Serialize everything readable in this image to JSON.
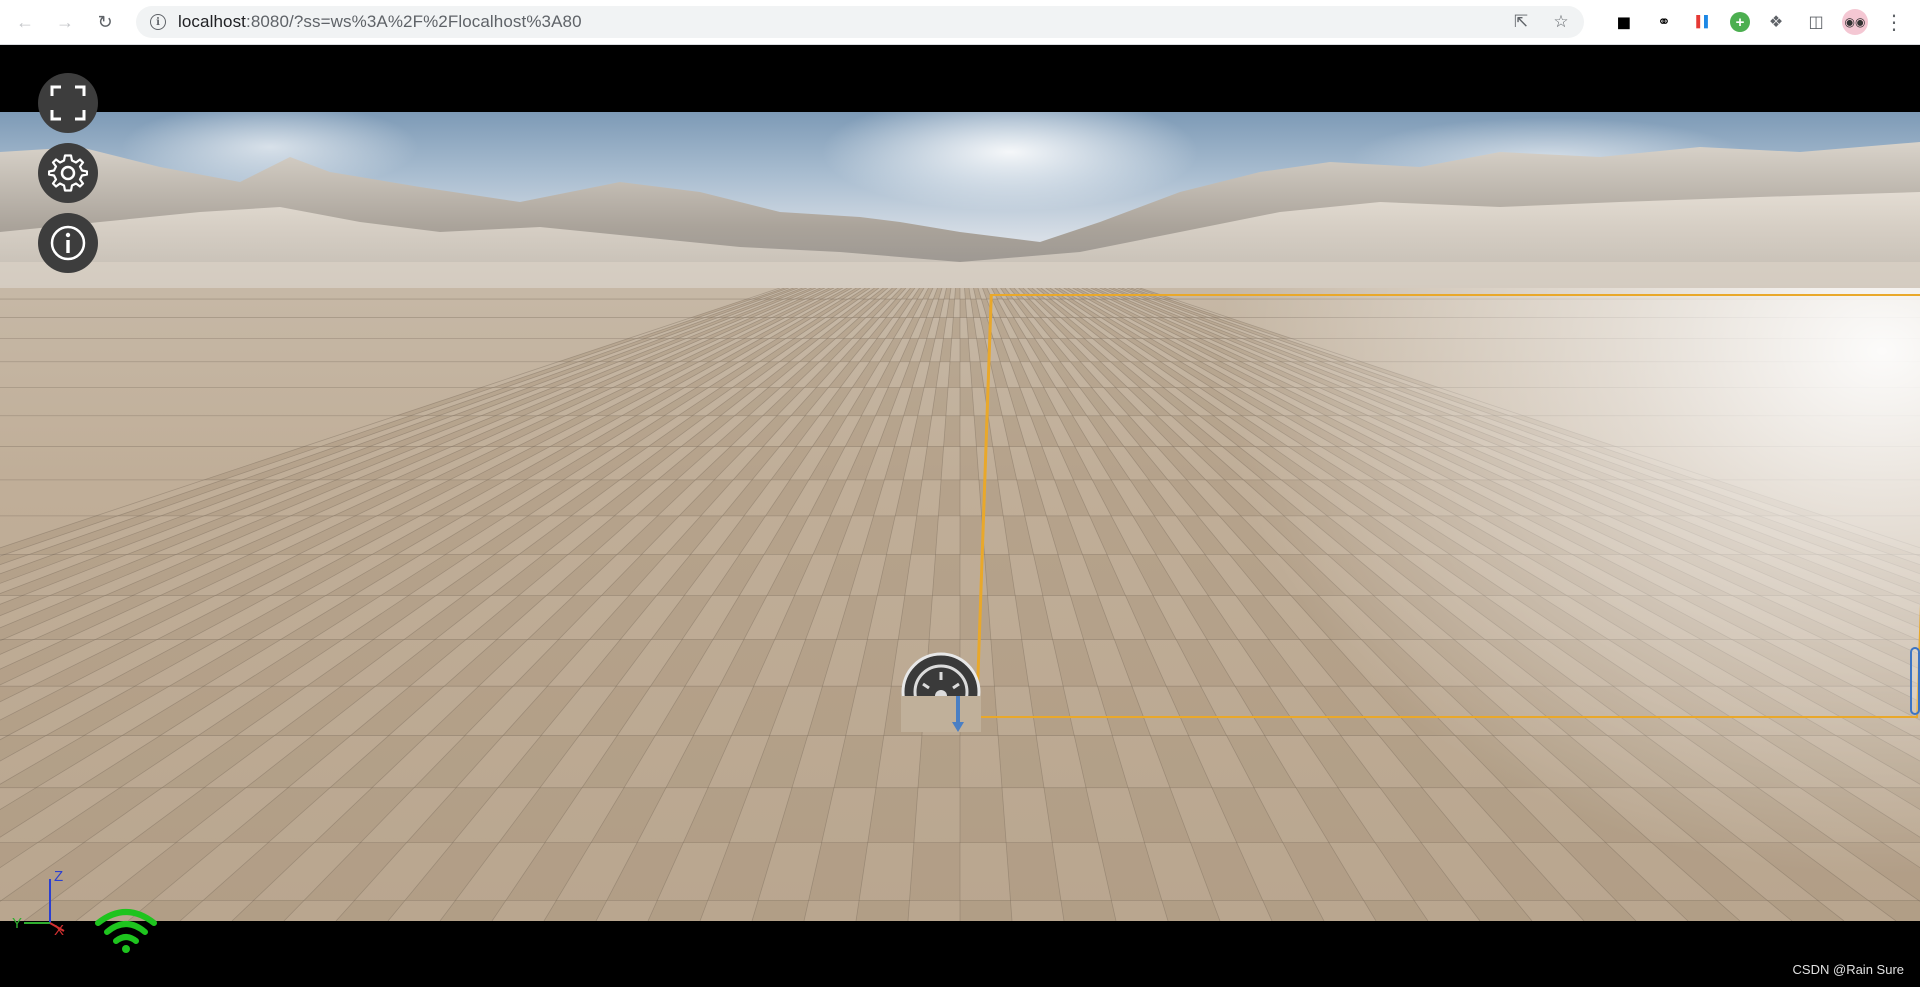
{
  "browser": {
    "url_host": "localhost",
    "url_rest": ":8080/?ss=ws%3A%2F%2Flocalhost%3A80",
    "icons": [
      "back-icon",
      "forward-icon",
      "reload-icon",
      "site-info-icon",
      "share-icon",
      "bookmark-star-icon",
      "extension-icons",
      "puzzle-icon",
      "side-panel-icon",
      "profile-avatar",
      "menu-icon"
    ]
  },
  "controls": {
    "buttons": [
      {
        "name": "fullscreen",
        "icon": "fullscreen-icon"
      },
      {
        "name": "settings",
        "icon": "gear-icon"
      },
      {
        "name": "info",
        "icon": "info-icon"
      }
    ]
  },
  "axis": {
    "z": "Z",
    "y": "Y",
    "x": "X"
  },
  "colors": {
    "selection": "#e9a82a",
    "wifi": "#1ec41e",
    "overlay_button": "#3d3d3d"
  },
  "watermark": "CSDN @Rain Sure"
}
